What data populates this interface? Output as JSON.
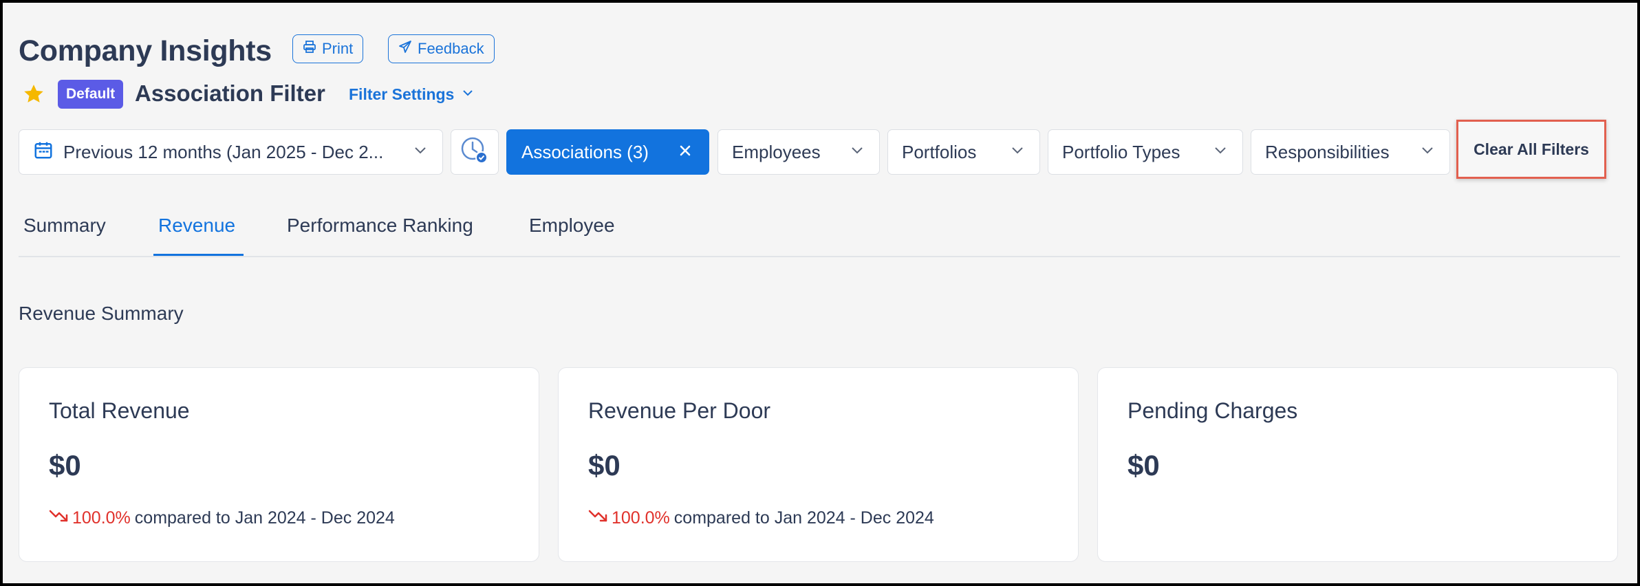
{
  "header": {
    "title": "Company Insights",
    "print_label": "Print",
    "feedback_label": "Feedback"
  },
  "filter_bar": {
    "badge": "Default",
    "name": "Association Filter",
    "settings_label": "Filter Settings",
    "date_range": "Previous 12 months (Jan 2025 - Dec 2...",
    "associations_chip": "Associations (3)",
    "dropdowns": [
      "Employees",
      "Portfolios",
      "Portfolio Types",
      "Responsibilities"
    ],
    "clear_all_label": "Clear All Filters"
  },
  "tabs": [
    {
      "label": "Summary",
      "active": false
    },
    {
      "label": "Revenue",
      "active": true
    },
    {
      "label": "Performance Ranking",
      "active": false
    },
    {
      "label": "Employee",
      "active": false
    }
  ],
  "section_title": "Revenue Summary",
  "cards": [
    {
      "title": "Total Revenue",
      "value": "$0",
      "change": "100.0%",
      "compare": "compared to Jan 2024 - Dec 2024"
    },
    {
      "title": "Revenue Per Door",
      "value": "$0",
      "change": "100.0%",
      "compare": "compared to Jan 2024 - Dec 2024"
    },
    {
      "title": "Pending Charges",
      "value": "$0"
    }
  ],
  "colors": {
    "accent": "#1273de",
    "text": "#2d3a55",
    "badge": "#5b5be6",
    "negative": "#e0312b",
    "star": "#f5b800",
    "highlight": "#e2604f"
  },
  "icons": [
    "printer-icon",
    "send-icon",
    "star-icon",
    "chevron-down-icon",
    "calendar-icon",
    "clock-check-icon",
    "close-icon",
    "trend-down-icon"
  ]
}
